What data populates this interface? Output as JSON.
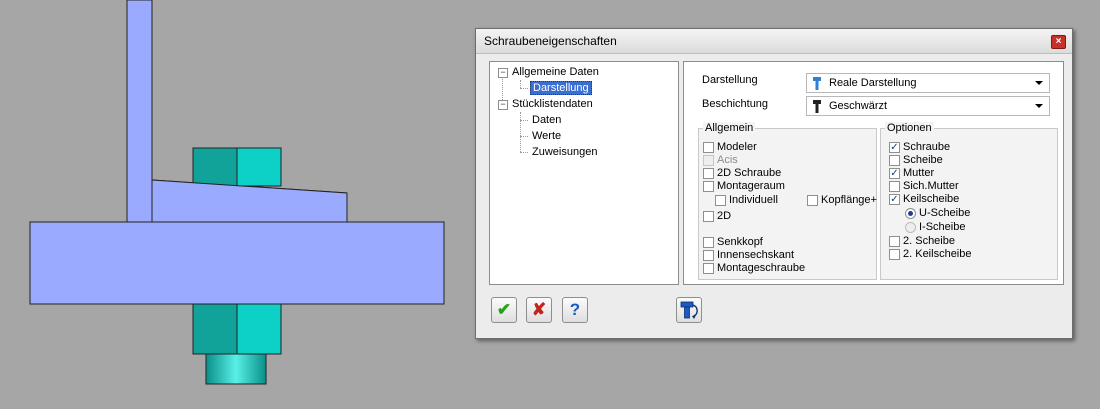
{
  "dialog": {
    "title": "Schraubeneigenschaften",
    "close_glyph": "×"
  },
  "tree": {
    "items": [
      {
        "label": "Allgemeine Daten",
        "expander": "−"
      },
      {
        "label": "Darstellung"
      },
      {
        "label": "Stücklistendaten",
        "expander": "−"
      },
      {
        "label": "Daten"
      },
      {
        "label": "Werte"
      },
      {
        "label": "Zuweisungen"
      }
    ]
  },
  "fields": {
    "darstellung_label": "Darstellung",
    "darstellung_value": "Reale Darstellung",
    "beschichtung_label": "Beschichtung",
    "beschichtung_value": "Geschwärzt"
  },
  "allgemein": {
    "title": "Allgemein",
    "modeler": "Modeler",
    "acis": "Acis",
    "schraube_2d": "2D Schraube",
    "montageraum": "Montageraum",
    "individuell": "Individuell",
    "kopflaenge": "Kopflänge+",
    "d2": "2D",
    "senkkopf": "Senkkopf",
    "innensechskant": "Innensechskant",
    "montageschraube": "Montageschraube"
  },
  "optionen": {
    "title": "Optionen",
    "schraube": "Schraube",
    "scheibe": "Scheibe",
    "mutter": "Mutter",
    "sich_mutter": "Sich.Mutter",
    "keilscheibe": "Keilscheibe",
    "u_scheibe": "U-Scheibe",
    "i_scheibe": "I-Scheibe",
    "scheibe2": "2. Scheibe",
    "keilscheibe2": "2. Keilscheibe"
  },
  "check_glyph": "✓",
  "buttons": {
    "ok_glyph": "✔",
    "cancel_glyph": "✘",
    "help_glyph": "?"
  },
  "colors": {
    "steel_plate": "#99aaff",
    "nut_dark": "#11a39a",
    "nut_light": "#0dd0c7",
    "ok_green": "#27a31b",
    "cancel_red": "#c0241b",
    "help_blue": "#1d5bc4"
  }
}
